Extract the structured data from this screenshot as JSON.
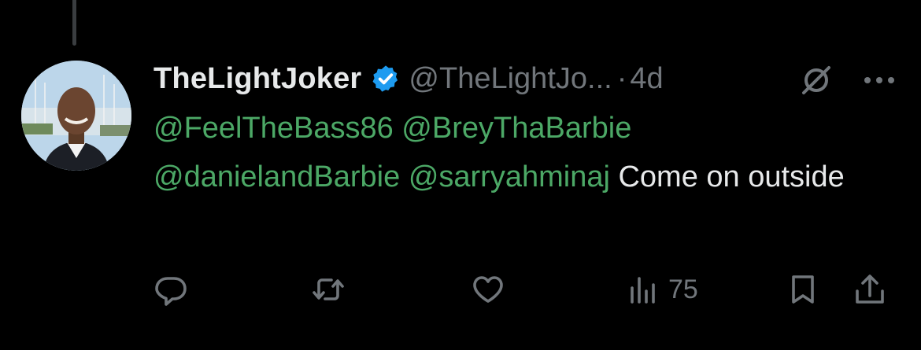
{
  "post": {
    "display_name": "TheLightJoker",
    "handle": "@TheLightJo...",
    "separator": "·",
    "time": "4d",
    "verified": true,
    "avatar": "profile-photo",
    "mentions": [
      "@FeelTheBass86",
      "@BreyThaBarbie",
      "@danielandBarbie",
      "@sarryahminaj"
    ],
    "text": "Come on outside"
  },
  "actions": {
    "reply": {
      "icon": "reply-icon"
    },
    "repost": {
      "icon": "repost-icon"
    },
    "like": {
      "icon": "heart-icon"
    },
    "views": {
      "icon": "views-icon",
      "count": "75"
    },
    "bookmark": {
      "icon": "bookmark-icon"
    },
    "share": {
      "icon": "share-icon"
    }
  },
  "colors": {
    "background": "#000000",
    "text": "#e7e9ea",
    "muted": "#71767b",
    "mention": "#4ca866",
    "verified": "#1d9bf0"
  }
}
